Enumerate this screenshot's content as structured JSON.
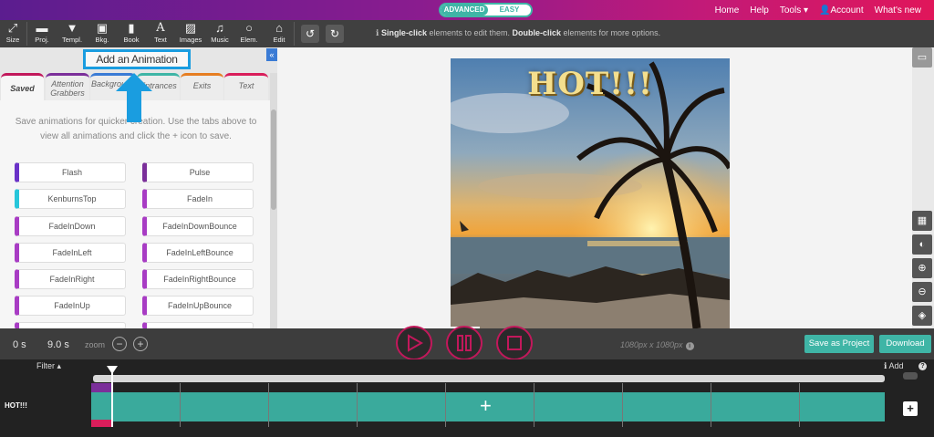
{
  "topbar": {
    "mode_advanced": "ADVANCED",
    "mode_easy": "EASY",
    "nav": [
      "Home",
      "Help",
      "Tools ▾",
      "Account",
      "What's new"
    ]
  },
  "toolbar": {
    "tools": [
      "Size",
      "Proj.",
      "Templ.",
      "Bkg.",
      "Book",
      "Text",
      "Images",
      "Music",
      "Elem.",
      "Edit"
    ],
    "hint_bold1": "Single-click",
    "hint_mid": " elements to edit them. ",
    "hint_bold2": "Double-click",
    "hint_end": " elements for more options."
  },
  "left_panel": {
    "callout": "Add an Animation",
    "tabs": [
      "Saved",
      "Attention Grabbers",
      "Background",
      "Entrances",
      "Exits",
      "Text"
    ],
    "description": "Save animations for quicker creation. Use the tabs above to view all animations and click the + icon to save.",
    "animations_left": [
      "Flash",
      "KenburnsTop",
      "FadeInDown",
      "FadeInLeft",
      "FadeInRight",
      "FadeInUp"
    ],
    "animations_right": [
      "Pulse",
      "FadeIn",
      "FadeInDownBounce",
      "FadeInLeftBounce",
      "FadeInRightBounce",
      "FadeInUpBounce"
    ]
  },
  "canvas": {
    "title_text": "HOT!!!"
  },
  "controls": {
    "time_current": "0 s",
    "time_total": "9.0 s",
    "zoom_label": "zoom",
    "dimensions": "1080px x 1080px",
    "save_project": "Save as Project",
    "download": "Download"
  },
  "timeline": {
    "filter": "Filter ▴",
    "add": "Add",
    "layer_name": "HOT!!!"
  },
  "colors": {
    "accent_teal": "#3fb5a6",
    "play_ring": "#c2185b",
    "callout_blue": "#1a9de0"
  }
}
